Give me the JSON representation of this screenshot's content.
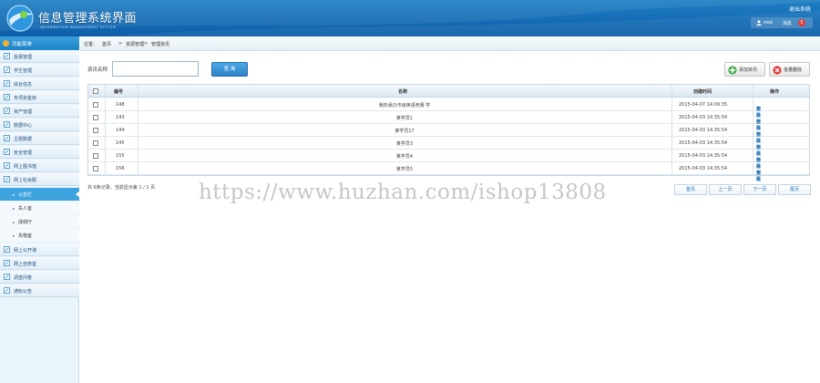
{
  "header": {
    "title": "信息管理系统界面",
    "subtitle": "INFORMATION MANAGEMENT SYSTEM",
    "exit_label": "退出系统",
    "user_name": "root",
    "messages_label": "消息",
    "message_count": "5",
    "colors": {
      "primary": "#0d5ea8",
      "badge": "#e23b3b"
    }
  },
  "sidebar": {
    "header": "功能菜单",
    "items_top": [
      "投报管理",
      "学生管理",
      "综合信息",
      "专项资金库",
      "资产管理",
      "数据中心",
      "主题数据",
      "安全管理",
      "网上图书馆",
      "网上社会服"
    ],
    "sub_items": [
      "公告栏",
      "失人室",
      "成绩厅",
      "失物室"
    ],
    "active_sub_index": 0,
    "items_bottom": [
      "网上公开课",
      "网上自修室",
      "调查问卷",
      "通知公告"
    ]
  },
  "breadcrumb": {
    "label": "位置：",
    "path": [
      "首页",
      "资源管理",
      "管理资讯"
    ],
    "sep": ">"
  },
  "search": {
    "label": "资讯名称",
    "value": "",
    "button": "查 询"
  },
  "actions": {
    "add": "添加资讯",
    "delete": "批量删除"
  },
  "table": {
    "columns": [
      "编号",
      "名称",
      "创建时间",
      "操作"
    ],
    "rows": [
      {
        "id": "148",
        "name": "我校承办市级英语竞赛 学",
        "time": "2015-04-07 14:09:35"
      },
      {
        "id": "143",
        "name": "某学员1",
        "time": "2015-04-03 14:35:54"
      },
      {
        "id": "144",
        "name": "某学员17",
        "time": "2015-04-03 14:35:54"
      },
      {
        "id": "145",
        "name": "某学员3",
        "time": "2015-04-03 14:35:54"
      },
      {
        "id": "155",
        "name": "某学员4",
        "time": "2015-04-03 14:35:54"
      },
      {
        "id": "156",
        "name": "某学员5",
        "time": "2015-04-03 14:35:54"
      }
    ],
    "ops": [
      "查看",
      "修改",
      "删除"
    ]
  },
  "pager": {
    "info": "共 6条记录，当前显示第 1 / 1 页",
    "first": "首页",
    "prev": "上一页",
    "next": "下一页",
    "last": "尾页"
  },
  "watermark": "https://www.huzhan.com/ishop13808"
}
